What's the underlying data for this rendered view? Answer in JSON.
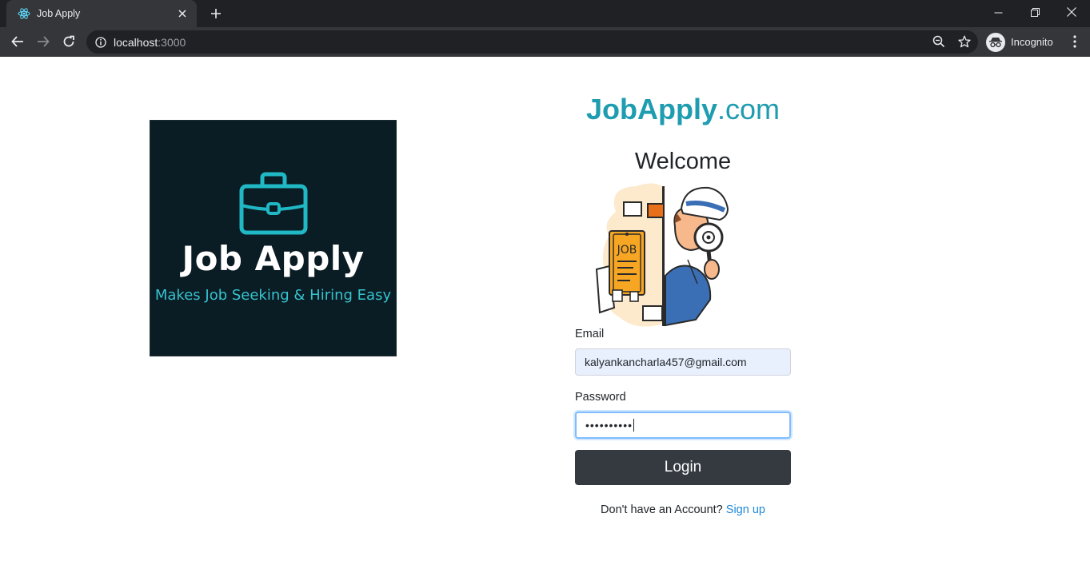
{
  "browser": {
    "tab_title": "Job Apply",
    "url_host": "localhost",
    "url_port": ":3000",
    "profile_label": "Incognito"
  },
  "logo": {
    "title": "Job Apply",
    "tagline": "Makes Job Seeking & Hiring Easy"
  },
  "brand": {
    "bold": "JobApply",
    "suffix": ".com"
  },
  "welcome": "Welcome",
  "illustration": {
    "sign_text": "JOB"
  },
  "form": {
    "email_label": "Email",
    "email_value": "kalyankancharla457@gmail.com",
    "password_label": "Password",
    "password_value": "••••••••••",
    "login_label": "Login",
    "signup_prompt": "Don't have an Account?",
    "signup_link": "Sign up"
  },
  "colors": {
    "brand": "#1e9cb0",
    "logo_bg": "#0a1c24",
    "logo_accent": "#36c3cf",
    "button": "#343a40",
    "link": "#1e88d8"
  }
}
